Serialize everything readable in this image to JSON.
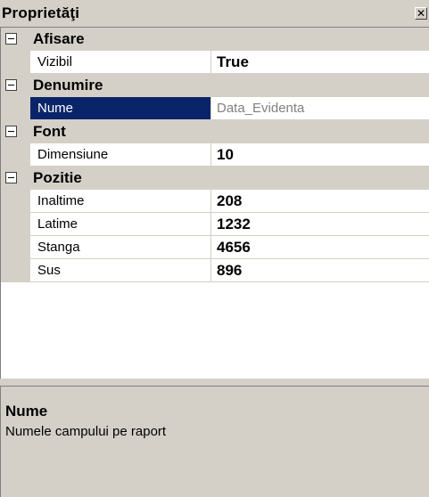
{
  "window": {
    "title": "Proprietăţi",
    "close_glyph": "✕"
  },
  "grid": {
    "categories": [
      {
        "label": "Afisare",
        "properties": [
          {
            "name": "Vizibil",
            "value": "True"
          }
        ]
      },
      {
        "label": "Denumire",
        "properties": [
          {
            "name": "Nume",
            "value": "Data_Evidenta",
            "selected": true,
            "readonly": true
          }
        ]
      },
      {
        "label": "Font",
        "properties": [
          {
            "name": "Dimensiune",
            "value": "10"
          }
        ]
      },
      {
        "label": "Pozitie",
        "properties": [
          {
            "name": "Inaltime",
            "value": "208"
          },
          {
            "name": "Latime",
            "value": "1232"
          },
          {
            "name": "Stanga",
            "value": "4656"
          },
          {
            "name": "Sus",
            "value": "896"
          }
        ]
      }
    ]
  },
  "description": {
    "title": "Nume",
    "text": "Numele campului pe raport"
  },
  "colors": {
    "selection": "#0a246a",
    "panel": "#d4d0c8",
    "readonly_text": "#808080"
  }
}
